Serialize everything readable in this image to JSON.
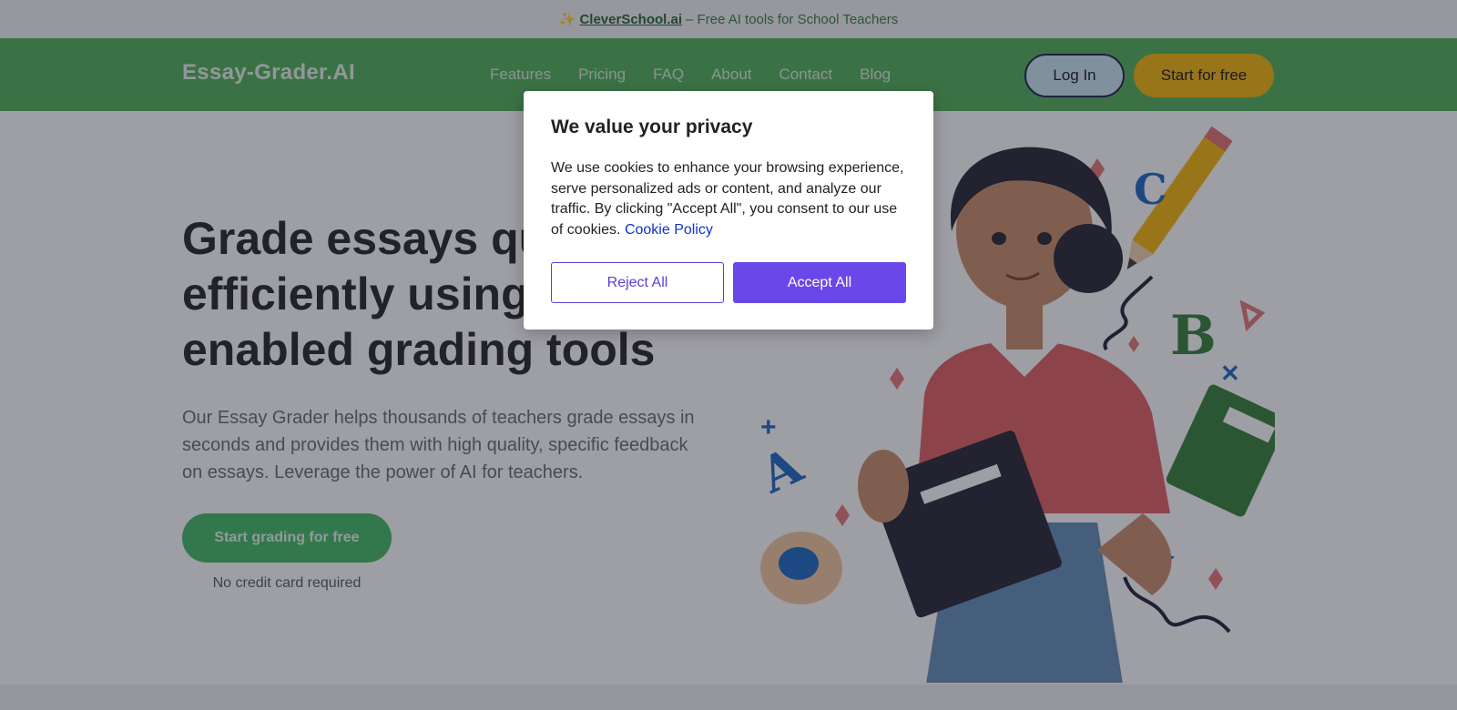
{
  "topbar": {
    "sparkle": "✨",
    "link_text": "CleverSchool.ai",
    "rest_text": "– Free AI tools for School Teachers"
  },
  "nav": {
    "logo": "Essay-Grader.AI",
    "items": [
      "Features",
      "Pricing",
      "FAQ",
      "About",
      "Contact",
      "Blog"
    ],
    "login": "Log In",
    "start": "Start for free"
  },
  "hero": {
    "headline": "Grade essays quickly and efficiently using our AI-enabled grading tools",
    "subtitle": "Our Essay Grader helps thousands of teachers grade essays in seconds and provides them with high quality, specific feedback on essays. Leverage the power of AI for teachers.",
    "cta": "Start grading for free",
    "note": "No credit card required"
  },
  "modal": {
    "title": "We value your privacy",
    "body": "We use cookies to enhance your browsing experience, serve personalized ads or content, and analyze our traffic. By clicking \"Accept All\", you consent to our use of cookies.",
    "policy_link": "Cookie Policy",
    "reject": "Reject All",
    "accept": "Accept All"
  },
  "colors": {
    "nav_bg": "#4caf50",
    "accent_yellow": "#f5b400",
    "modal_accent": "#6a47e8"
  }
}
